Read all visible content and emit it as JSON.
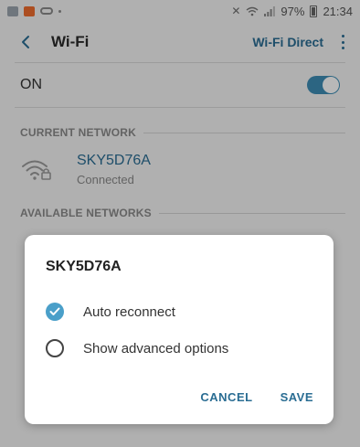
{
  "status_bar": {
    "battery": "97%",
    "time": "21:34",
    "icons": [
      "gallery-icon",
      "notification-app-icon",
      "voicemail-icon",
      "more-dot-icon",
      "mute-icon",
      "wifi-icon",
      "signal-icon",
      "battery-icon"
    ]
  },
  "header": {
    "title": "Wi-Fi",
    "action": "Wi-Fi Direct",
    "back_icon": "back-chevron-icon",
    "more_icon": "more-vertical-icon"
  },
  "toggle": {
    "label": "ON",
    "state": "on",
    "accent": "#3d8db5"
  },
  "current_network": {
    "section": "CURRENT NETWORK",
    "name": "SKY5D76A",
    "status": "Connected",
    "icon": "secured-wifi-icon"
  },
  "available_networks": {
    "section": "AVAILABLE NETWORKS"
  },
  "dialog": {
    "title": "SKY5D76A",
    "options": [
      {
        "label": "Auto reconnect",
        "checked": true
      },
      {
        "label": "Show advanced options",
        "checked": false
      }
    ],
    "cancel": "CANCEL",
    "save": "SAVE"
  },
  "colors": {
    "link": "#2a6d93",
    "check": "#4a9fc9"
  }
}
